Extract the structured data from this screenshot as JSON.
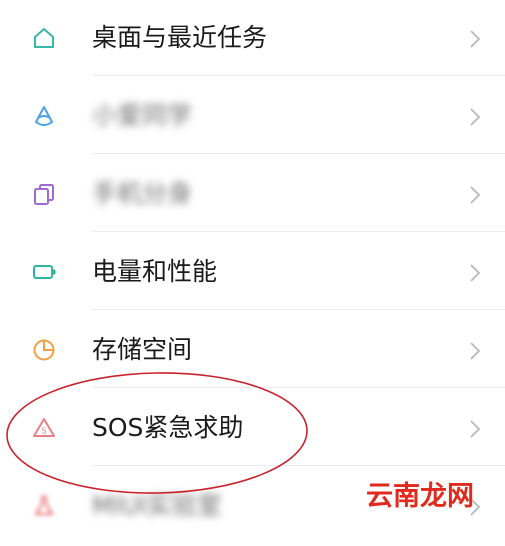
{
  "settings_list": {
    "items": [
      {
        "label": "桌面与最近任务",
        "icon": "home-icon",
        "icon_color": "#39b7a9",
        "blurred": false
      },
      {
        "label": "小爱同学",
        "icon": "xiaoai-icon",
        "icon_color": "#4aa3e8",
        "blurred": true
      },
      {
        "label": "手机分身",
        "icon": "copy-icon",
        "icon_color": "#a06ad0",
        "blurred": true
      },
      {
        "label": "电量和性能",
        "icon": "battery-icon",
        "icon_color": "#2fb59e",
        "blurred": false
      },
      {
        "label": "存储空间",
        "icon": "pie-chart-icon",
        "icon_color": "#f0a045",
        "blurred": false
      },
      {
        "label": "SOS紧急求助",
        "icon": "sos-alert-icon",
        "icon_color": "#e8808a",
        "blurred": false
      },
      {
        "label": "MIUI实验室",
        "icon": "lab-icon",
        "icon_color": "#e86a6a",
        "blurred": true
      }
    ]
  },
  "annotation": {
    "color": "#c8232c",
    "target": "SOS紧急求助"
  },
  "watermark": {
    "text": "云南龙网",
    "color": "#e02a1e"
  }
}
